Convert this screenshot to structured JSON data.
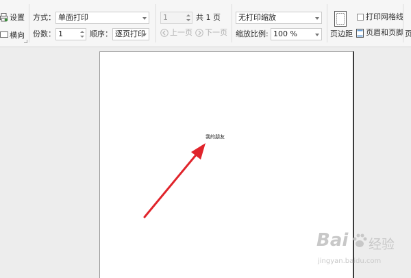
{
  "toolbar": {
    "settings_label": "设置",
    "landscape_label": "横向",
    "mode_label": "方式：",
    "mode_value": "单面打印",
    "copies_label": "份数：",
    "copies_value": "1",
    "order_label": "顺序：",
    "order_value": "逐页打印",
    "page_value": "1",
    "total_pages": "共 1 页",
    "prev_page_label": "上一页",
    "next_page_label": "下一页",
    "scale_mode_value": "无打印缩放",
    "zoom_label": "缩放比例:",
    "zoom_value": "100 %",
    "margins_label": "页边距",
    "print_gridlines_label": "打印网格线",
    "header_footer_label": "页眉和页脚",
    "more_label": "页"
  },
  "document": {
    "text": "我的朋友"
  },
  "annotation": {
    "arrow_color": "#e0242b"
  },
  "watermark": {
    "brand": "Bai",
    "brand_suffix": "经验",
    "url": "jingyan.baidu.com"
  }
}
